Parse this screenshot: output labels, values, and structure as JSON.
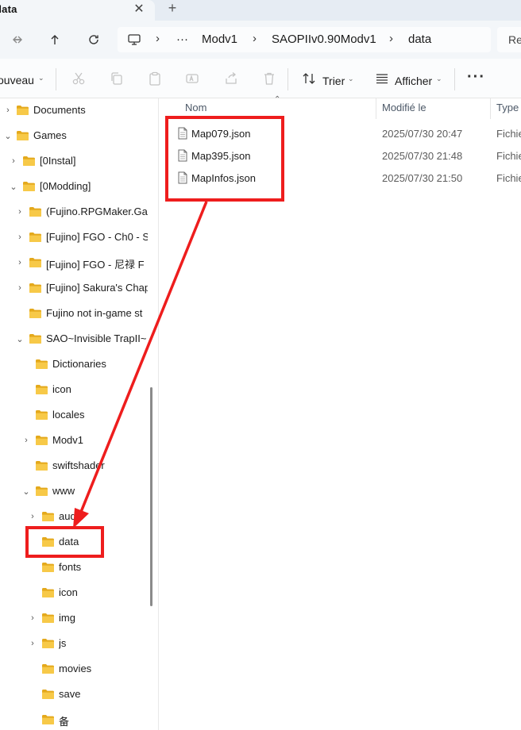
{
  "tab": {
    "title": "data",
    "close_glyph": "✕",
    "new_tab_glyph": "+"
  },
  "nav": {
    "back_icon": "arrow-left-icon",
    "forward_icon": "arrow-right-icon",
    "up_icon": "arrow-up-icon",
    "refresh_icon": "refresh-icon",
    "breadcrumb": [
      "Modv1",
      "SAOPIIv0.90Modv1",
      "data"
    ],
    "overflow_glyph": "···",
    "search_stub": "Re"
  },
  "commands": {
    "new_label": "ouveau",
    "sort_label": "Trier",
    "view_label": "Afficher",
    "more_glyph": "···",
    "icons": [
      "cut-icon",
      "copy-icon",
      "paste-icon",
      "rename-icon",
      "share-icon",
      "delete-icon",
      "sort-icon",
      "view-icon"
    ]
  },
  "tree": [
    {
      "label": "Documents",
      "expander": "›"
    },
    {
      "label": "Games",
      "expander": "⌄"
    },
    {
      "label": "[0Instal]",
      "expander": "›"
    },
    {
      "label": "[0Modding]",
      "expander": "⌄"
    },
    {
      "label": "(Fujino.RPGMaker.Gar",
      "expander": "›"
    },
    {
      "label": "[Fujino] FGO - Ch0 - S",
      "expander": "›"
    },
    {
      "label": "[Fujino] FGO - 尼禄 F",
      "expander": "›"
    },
    {
      "label": "[Fujino] Sakura's Chap",
      "expander": "›"
    },
    {
      "label": "Fujino not in-game st",
      "expander": ""
    },
    {
      "label": "SAO~Invisible TrapII~",
      "expander": "⌄"
    },
    {
      "label": "Dictionaries",
      "expander": ""
    },
    {
      "label": "icon",
      "expander": ""
    },
    {
      "label": "locales",
      "expander": ""
    },
    {
      "label": "Modv1",
      "expander": "›"
    },
    {
      "label": "swiftshader",
      "expander": ""
    },
    {
      "label": "www",
      "expander": "⌄"
    },
    {
      "label": "audio",
      "expander": "›"
    },
    {
      "label": "data",
      "expander": ""
    },
    {
      "label": "fonts",
      "expander": ""
    },
    {
      "label": "icon",
      "expander": ""
    },
    {
      "label": "img",
      "expander": "›"
    },
    {
      "label": "js",
      "expander": "›"
    },
    {
      "label": "movies",
      "expander": ""
    },
    {
      "label": "save",
      "expander": ""
    },
    {
      "label": "备",
      "expander": ""
    }
  ],
  "columns": {
    "name": "Nom",
    "modified": "Modifié le",
    "type": "Type"
  },
  "files": [
    {
      "name": "Map079.json",
      "modified": "2025/07/30 20:47",
      "type": "Fichie"
    },
    {
      "name": "Map395.json",
      "modified": "2025/07/30 21:48",
      "type": "Fichie"
    },
    {
      "name": "MapInfos.json",
      "modified": "2025/07/30 21:50",
      "type": "Fichie"
    }
  ],
  "colors": {
    "annotation_red": "#ee1d1d",
    "folder_yellow": "#f7c948",
    "folder_dark": "#e4a91c"
  }
}
